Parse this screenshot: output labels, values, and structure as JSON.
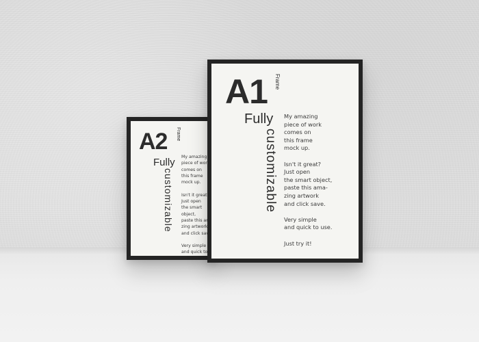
{
  "frames": {
    "a2": {
      "title": "A2",
      "small_label": "Frame",
      "headline": "Fully",
      "vertical_text": "customizable",
      "body": "My amazing\npiece of work\ncomes on\nthis frame\nmock up.\n\nIsn't it great?\nJust open\nthe smart object,\npaste this ama-\nzing artwork\nand click save.\n\nVery simple\nand quick to use.\n\nJust try it!"
    },
    "a1": {
      "title": "A1",
      "small_label": "Frame",
      "headline": "Fully",
      "vertical_text": "customizable",
      "body": "My amazing\npiece of work\ncomes on\nthis frame\nmock up.\n\nIsn't it great?\nJust open\nthe smart object,\npaste this ama-\nzing artwork\nand click save.\n\nVery simple\nand quick to use.\n\nJust try it!"
    }
  },
  "colors": {
    "frame": "#242424",
    "paper": "#f5f5f2",
    "text": "#2c2c2c"
  }
}
